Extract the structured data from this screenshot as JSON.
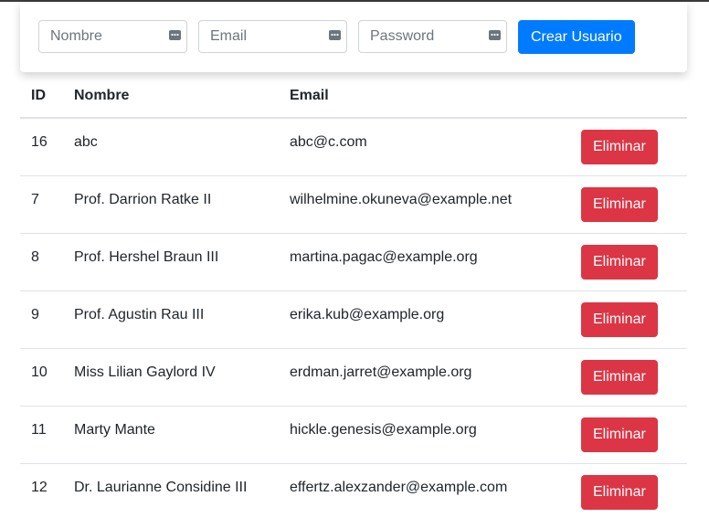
{
  "form": {
    "nombre_placeholder": "Nombre",
    "email_placeholder": "Email",
    "password_placeholder": "Password",
    "create_label": "Crear Usuario"
  },
  "table": {
    "headers": {
      "id": "ID",
      "nombre": "Nombre",
      "email": "Email"
    },
    "delete_label": "Eliminar",
    "rows": [
      {
        "id": "16",
        "nombre": "abc",
        "email": "abc@c.com"
      },
      {
        "id": "7",
        "nombre": "Prof. Darrion Ratke II",
        "email": "wilhelmine.okuneva@example.net"
      },
      {
        "id": "8",
        "nombre": "Prof. Hershel Braun III",
        "email": "martina.pagac@example.org"
      },
      {
        "id": "9",
        "nombre": "Prof. Agustin Rau III",
        "email": "erika.kub@example.org"
      },
      {
        "id": "10",
        "nombre": "Miss Lilian Gaylord IV",
        "email": "erdman.jarret@example.org"
      },
      {
        "id": "11",
        "nombre": "Marty Mante",
        "email": "hickle.genesis@example.org"
      },
      {
        "id": "12",
        "nombre": "Dr. Laurianne Considine III",
        "email": "effertz.alexzander@example.com"
      }
    ]
  },
  "colors": {
    "primary": "#007bff",
    "danger": "#dc3545"
  }
}
